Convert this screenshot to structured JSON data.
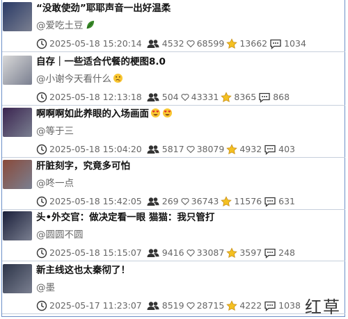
{
  "items": [
    {
      "title": "“没敢使劲”耶耶声音一出好温柔",
      "author": "@爱吃土豆",
      "author_suffix_icon": "leaf-icon",
      "date": "2025-05-18 15:20:14",
      "viewers": "4532",
      "likes": "68599",
      "stars": "13662",
      "comments": "1034",
      "thumb_color": "#2a3a66"
    },
    {
      "title": "自存｜一些适合代餐的梗图8.0",
      "author": "@小谢今天看什么",
      "author_suffix_icon": "thinking-face-icon",
      "date": "2025-05-18 12:13:18",
      "viewers": "504",
      "likes": "43331",
      "stars": "8365",
      "comments": "868",
      "thumb_color": "#d8d8d8"
    },
    {
      "title": "啊啊啊如此养眼的入场画面",
      "title_suffix_icon": "heart-eyes-icon",
      "author": "@等于三",
      "date": "2025-05-18 15:04:20",
      "viewers": "5817",
      "likes": "38079",
      "stars": "4932",
      "comments": "403",
      "thumb_color": "#3a2450"
    },
    {
      "title": "肝脏刻字，究竟多可怕",
      "author": "@咚一点",
      "date": "2025-05-18 15:42:05",
      "viewers": "269",
      "likes": "36743",
      "stars": "11576",
      "comments": "631",
      "thumb_color": "#8a4a3a"
    },
    {
      "title": "头•外交官：做决定看一眼 猫猫：我只管打",
      "author": "@圆圆不圆",
      "date": "2025-05-18 15:15:07",
      "viewers": "9416",
      "likes": "33087",
      "stars": "3597",
      "comments": "248",
      "thumb_color": "#1a1f3a"
    },
    {
      "title": "新主线这也太秦彻了！",
      "author": "@墨",
      "date": "2025-05-17 11:23:07",
      "viewers": "8519",
      "likes": "28715",
      "stars": "4222",
      "comments": "1038",
      "thumb_color": "#2c3448"
    }
  ],
  "watermark": "红草"
}
